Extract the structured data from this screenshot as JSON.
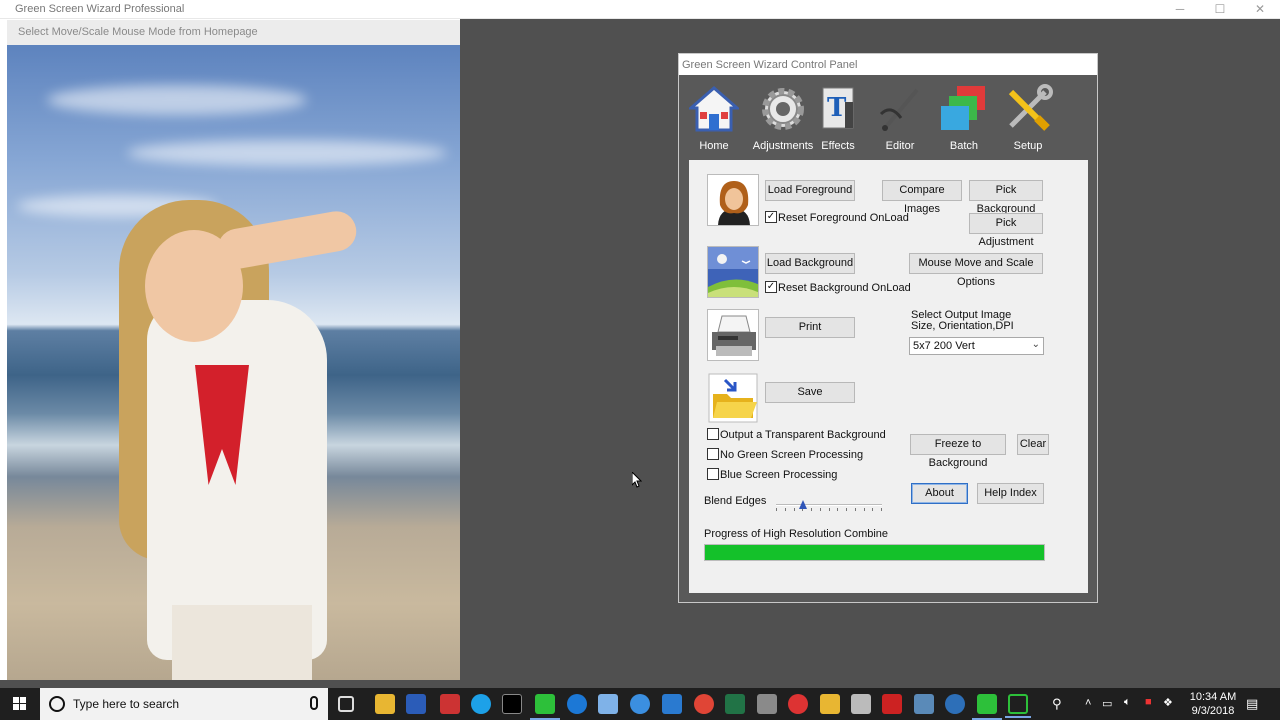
{
  "window": {
    "title": "Green Screen Wizard Professional",
    "minimize": "─",
    "maximize": "☐",
    "close": "✕"
  },
  "hint": "Select Move/Scale Mouse Mode from Homepage",
  "panel": {
    "title": "Green Screen Wizard Control Panel",
    "toolbar": [
      {
        "label": "Home",
        "icon": "home-icon"
      },
      {
        "label": "Adjustments",
        "icon": "gear-icon"
      },
      {
        "label": "Effects",
        "icon": "effects-icon"
      },
      {
        "label": "Editor",
        "icon": "editor-icon"
      },
      {
        "label": "Batch",
        "icon": "batch-icon"
      },
      {
        "label": "Setup",
        "icon": "tools-icon"
      }
    ],
    "buttons": {
      "load_foreground": "Load Foreground",
      "compare_images": "Compare Images",
      "pick_background": "Pick Background",
      "pick_adjustment": "Pick Adjustment",
      "load_background": "Load Background",
      "mouse_move_scale": "Mouse Move and Scale Options",
      "print": "Print",
      "save": "Save",
      "freeze_to_background": "Freeze to Background",
      "clear": "Clear",
      "about": "About",
      "help_index": "Help Index"
    },
    "checkboxes": {
      "reset_foreground": {
        "label": "Reset Foreground OnLoad",
        "checked": true
      },
      "reset_background": {
        "label": "Reset Background OnLoad",
        "checked": true
      },
      "transparent_bg": {
        "label": "Output a Transparent Background",
        "checked": false
      },
      "no_green": {
        "label": "No Green Screen Processing",
        "checked": false
      },
      "blue_screen": {
        "label": "Blue Screen Processing",
        "checked": false
      }
    },
    "output_size": {
      "label": "Select Output Image Size, Orientation,DPI",
      "selected": "5x7 200 Vert"
    },
    "blend_edges": {
      "label": "Blend Edges",
      "value_fraction": 0.25
    },
    "progress": {
      "label": "Progress of High Resolution Combine",
      "percent": 100
    }
  },
  "taskbar": {
    "search_placeholder": "Type here to search",
    "time": "10:34 AM",
    "date": "9/3/2018"
  },
  "colors": {
    "progress": "#14c12a",
    "panel_bg": "#595959",
    "desktop_bg": "#505050"
  }
}
